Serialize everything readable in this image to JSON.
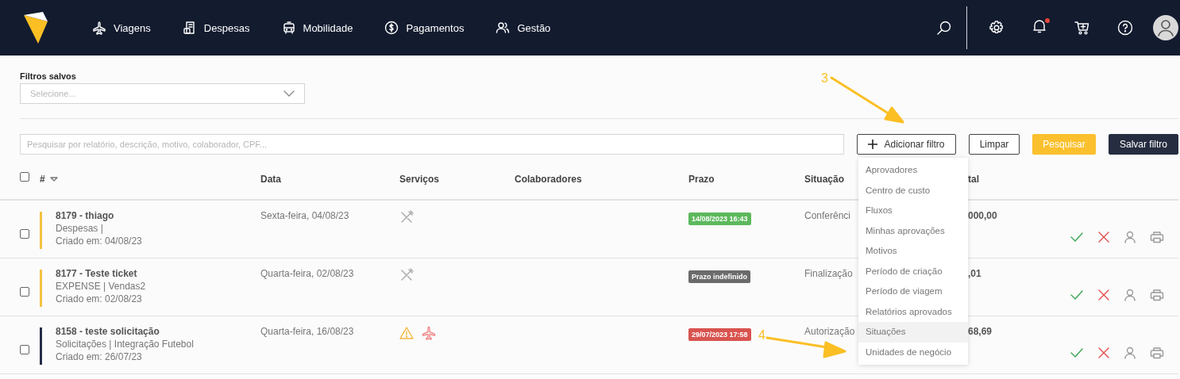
{
  "nav": {
    "items": [
      {
        "label": "Viagens"
      },
      {
        "label": "Despesas"
      },
      {
        "label": "Mobilidade"
      },
      {
        "label": "Pagamentos"
      },
      {
        "label": "Gestão"
      }
    ],
    "notification_dot": true
  },
  "saved_filters": {
    "label": "Filtros salvos",
    "placeholder": "Selecione..."
  },
  "search": {
    "placeholder": "Pesquisar por relatório, descrição, motivo, colaborador, CPF..."
  },
  "buttons": [
    {
      "label": "Adicionar filtro",
      "kind": "add"
    },
    {
      "label": "Limpar",
      "kind": "outline"
    },
    {
      "label": "Pesquisar",
      "kind": "primary"
    },
    {
      "label": "Salvar filtro",
      "kind": "dark"
    }
  ],
  "table": {
    "select_all_checked": false,
    "columns": [
      "#",
      "Data",
      "Serviços",
      "Colaboradores",
      "Prazo",
      "Situação",
      "tal"
    ],
    "rows": [
      {
        "checked": false,
        "color": "#f5c242",
        "title": "8179 - thiago",
        "subtitle": "Despesas |",
        "created": "Criado em: 04/08/23",
        "date": "Sexta-feira, 04/08/23",
        "services": [
          {
            "kind": "meal"
          }
        ],
        "deadline": {
          "text": "14/08/2023 16:43",
          "kind": "ok"
        },
        "status": "Conferênci",
        "total": "000,00"
      },
      {
        "checked": false,
        "color": "#f5c242",
        "title": "8177 - Teste ticket",
        "subtitle": "EXPENSE | Vendas2",
        "created": "Criado em: 02/08/23",
        "date": "Quarta-feira, 02/08/23",
        "services": [
          {
            "kind": "meal"
          }
        ],
        "deadline": {
          "text": "Prazo indefinido",
          "kind": "none"
        },
        "status": "Finalização",
        "total": ",01"
      },
      {
        "checked": false,
        "color": "#262d4a",
        "title": "8158 - teste solicitação",
        "subtitle": "Solicitações | Integração Futebol",
        "created": "Criado em: 26/07/23",
        "date": "Quarta-feira, 16/08/23",
        "services": [
          {
            "kind": "warning"
          },
          {
            "kind": "flight"
          }
        ],
        "deadline": {
          "text": "29/07/2023 17:58",
          "kind": "late"
        },
        "status": "Autorização",
        "total": "68,69"
      }
    ]
  },
  "filter_menu": [
    {
      "label": "Aprovadores",
      "selected": false
    },
    {
      "label": "Centro de custo",
      "selected": false
    },
    {
      "label": "Fluxos",
      "selected": false
    },
    {
      "label": "Minhas aprovações",
      "selected": false
    },
    {
      "label": "Motivos",
      "selected": false
    },
    {
      "label": "Período de criação",
      "selected": false
    },
    {
      "label": "Período de viagem",
      "selected": false
    },
    {
      "label": "Relatórios aprovados",
      "selected": false
    },
    {
      "label": "Situações",
      "selected": true
    },
    {
      "label": "Unidades de negócio",
      "selected": false
    }
  ],
  "annotations": [
    {
      "label": "3",
      "kind": "down"
    },
    {
      "label": "4",
      "kind": "right"
    }
  ]
}
